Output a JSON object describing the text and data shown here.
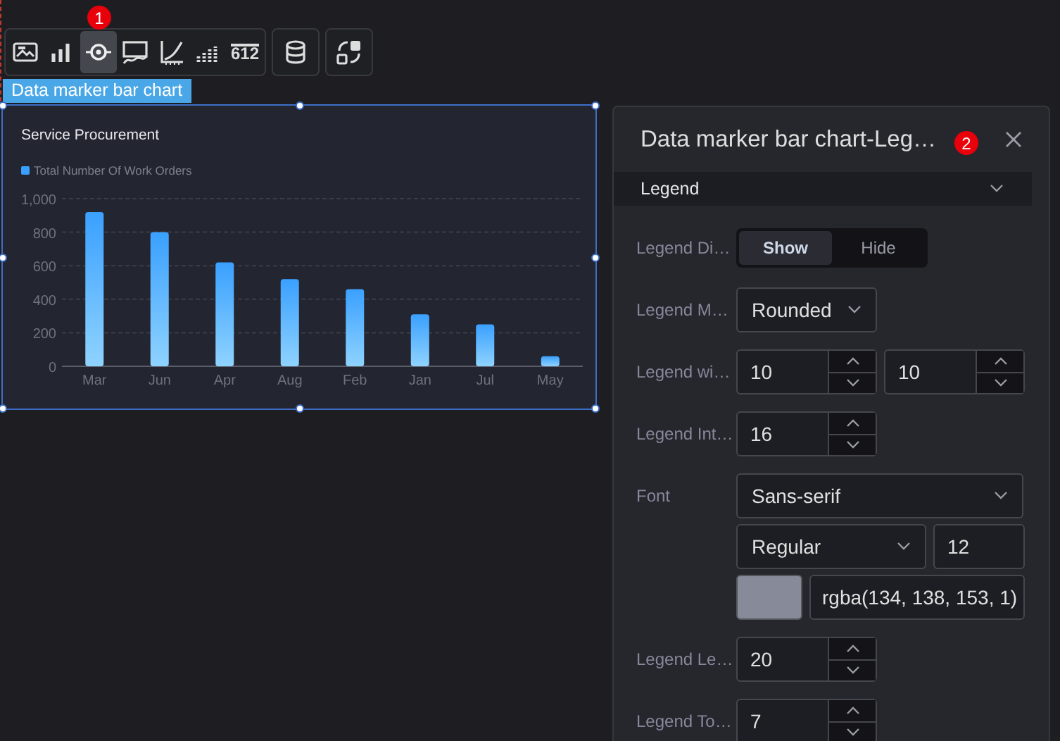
{
  "toolbar": {
    "badge": "1",
    "groups": [
      [
        {
          "kind": "image",
          "selected": false
        },
        {
          "kind": "bars",
          "selected": false
        },
        {
          "kind": "target",
          "selected": true
        },
        {
          "kind": "board",
          "selected": false
        },
        {
          "kind": "curve",
          "selected": false
        },
        {
          "kind": "dotbars",
          "selected": false
        },
        {
          "kind": "number",
          "label": "612",
          "selected": false
        }
      ],
      [
        {
          "kind": "database",
          "selected": false
        }
      ],
      [
        {
          "kind": "swap",
          "selected": false
        }
      ]
    ]
  },
  "component_label": "Data marker bar chart",
  "chart": {
    "title": "Service Procurement",
    "chart_data": {
      "type": "bar",
      "categories": [
        "Mar",
        "Jun",
        "Apr",
        "Aug",
        "Feb",
        "Jan",
        "Jul",
        "May"
      ],
      "series": [
        {
          "name": "Total Number Of Work Orders",
          "color": "#3aa0ff",
          "values": [
            920,
            800,
            620,
            520,
            460,
            310,
            250,
            60
          ]
        }
      ],
      "grid": true,
      "ylim": [
        0,
        1000
      ],
      "yticks": [
        0,
        200,
        400,
        600,
        800,
        {
          "value": 1000,
          "label": "1,000"
        }
      ]
    }
  },
  "panel": {
    "title": "Data marker bar chart-Leg…",
    "badge": "2",
    "section": {
      "label": "Legend",
      "expanded": true
    },
    "fields": [
      {
        "kind": "toggle",
        "label": "Legend Di…",
        "options": [
          {
            "label": "Show",
            "selected": true
          },
          {
            "label": "Hide",
            "selected": false
          }
        ]
      },
      {
        "kind": "select",
        "label": "Legend M…",
        "value": "Rounded"
      },
      {
        "kind": "spinners",
        "label": "Legend wi…",
        "values": [
          "10",
          "10"
        ]
      },
      {
        "kind": "spinner",
        "label": "Legend Int…",
        "value": "16"
      },
      {
        "kind": "font",
        "label": "Font",
        "family": "Sans-serif",
        "weight": "Regular",
        "size": "12",
        "color_text": "rgba(134, 138, 153, 1)"
      },
      {
        "kind": "spinner",
        "label": "Legend Le…",
        "value": "20"
      },
      {
        "kind": "spinner",
        "label": "Legend To…",
        "value": "7"
      }
    ]
  }
}
